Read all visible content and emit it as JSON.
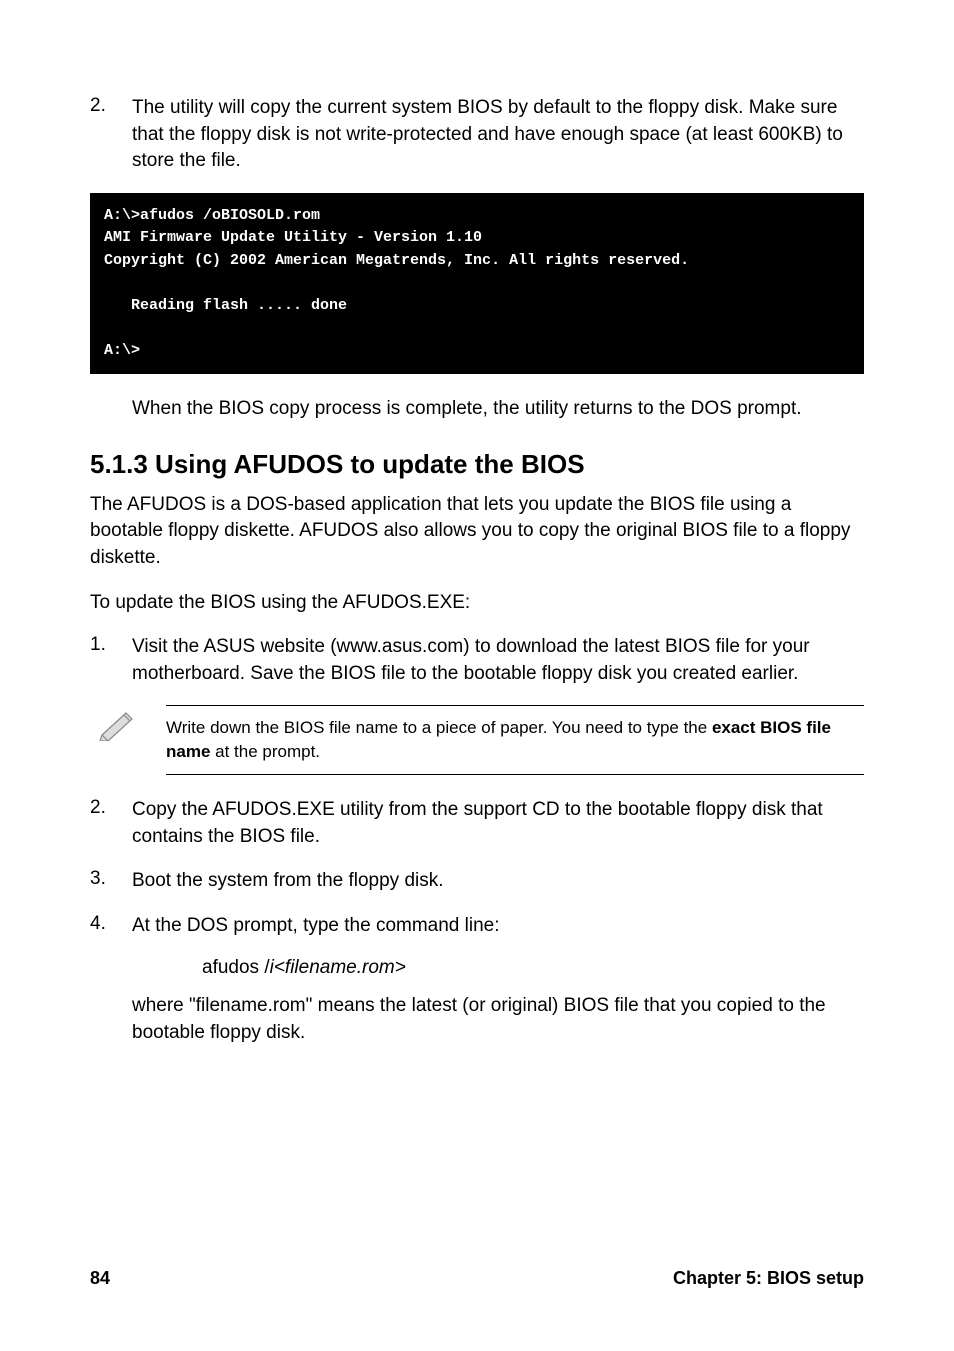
{
  "step2": {
    "num": "2.",
    "text": "The utility will copy the current system BIOS by default to the floppy disk. Make sure that the floppy disk is not write-protected and have enough space (at least 600KB) to store the file."
  },
  "code_block": "A:\\>afudos /oBIOSOLD.rom\nAMI Firmware Update Utility - Version 1.10\nCopyright (C) 2002 American Megatrends, Inc. All rights reserved.\n\n   Reading flash ..... done\n\nA:\\>",
  "after_code": "When the BIOS copy process is complete, the utility returns to the DOS prompt.",
  "heading": "5.1.3  Using AFUDOS to update the BIOS",
  "intro1": "The AFUDOS is a DOS-based application that lets you update the BIOS file using a bootable floppy diskette. AFUDOS also allows you to copy the original BIOS file to a floppy diskette.",
  "intro2": "To update the BIOS using the AFUDOS.EXE:",
  "list1": {
    "num": "1.",
    "text": "Visit the ASUS website (www.asus.com) to download the latest BIOS file for your motherboard. Save the BIOS file to the bootable floppy disk you created earlier."
  },
  "note": {
    "pre": "Write down the BIOS file name to a piece of paper. You need to type the ",
    "bold": "exact BIOS file name",
    "post": " at the prompt."
  },
  "list2": {
    "num": "2.",
    "text": "Copy the AFUDOS.EXE utility from the support CD to the bootable floppy disk that contains the BIOS file."
  },
  "list3": {
    "num": "3.",
    "text": "Boot the system from the floppy disk."
  },
  "list4": {
    "num": "4.",
    "text": "At the DOS prompt, type the command line:"
  },
  "cmd": {
    "plain": "afudos /",
    "italic": "i<filename.rom>"
  },
  "where": "where \"filename.rom\" means the latest (or original) BIOS file that you copied to the bootable floppy disk.",
  "footer": {
    "page": "84",
    "chapter": "Chapter 5: BIOS setup"
  }
}
